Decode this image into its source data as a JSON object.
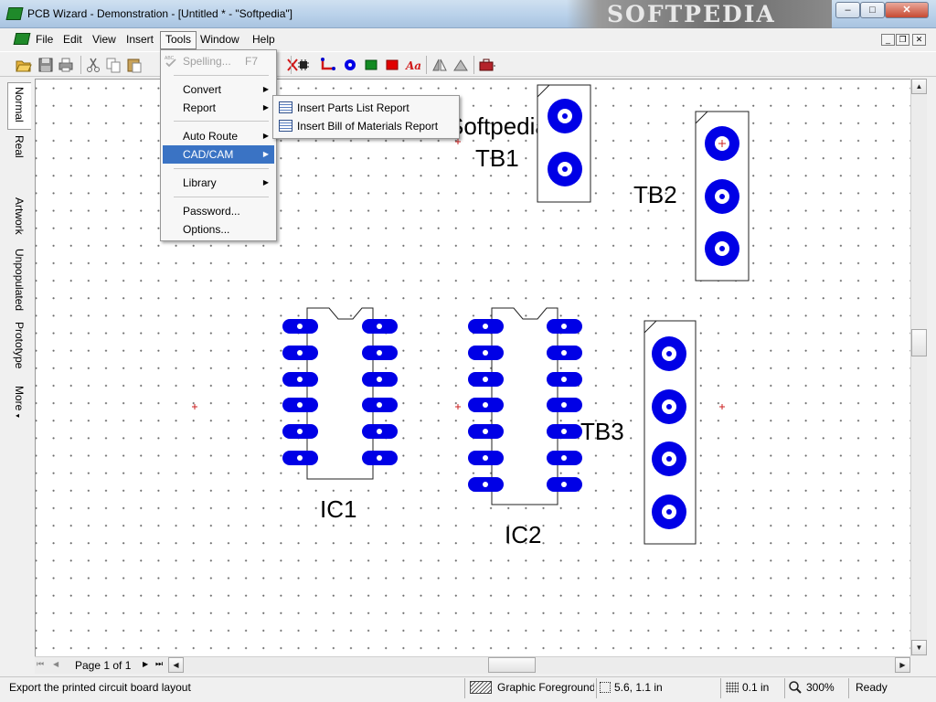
{
  "window": {
    "title": "PCB Wizard - Demonstration - [Untitled * - \"Softpedia\"]",
    "watermark": "SOFTPEDIA",
    "minimize": "–",
    "maximize": "□",
    "close": "✕"
  },
  "menubar": {
    "items": [
      "File",
      "Edit",
      "View",
      "Insert",
      "Tools",
      "Window",
      "Help"
    ],
    "active": "Tools",
    "mdi_minimize": "_",
    "mdi_restore": "❐",
    "mdi_close": "✕"
  },
  "tools_menu": {
    "spelling": {
      "label": "Spelling...",
      "shortcut": "F7",
      "disabled": true
    },
    "items": [
      {
        "label": "Convert",
        "submenu": true
      },
      {
        "label": "Report",
        "submenu": true
      },
      {
        "label": "Auto Route",
        "submenu": true
      },
      {
        "label": "CAD/CAM",
        "submenu": true,
        "highlighted": true
      },
      {
        "label": "Library",
        "submenu": true
      },
      {
        "label": "Password..."
      },
      {
        "label": "Options..."
      }
    ],
    "submenu_arrow": "▶"
  },
  "submenu": {
    "items": [
      "Insert Parts List Report",
      "Insert Bill of Materials Report"
    ]
  },
  "left_tabs": [
    "Normal",
    "Real World",
    "Artwork",
    "Unpopulated",
    "Prototype",
    "More"
  ],
  "left_tabs_more_arrow": "◂",
  "canvas": {
    "labels": {
      "softpedia": "Softpedia",
      "tb1": "TB1",
      "tb2": "TB2",
      "tb3": "TB3",
      "ic1": "IC1",
      "ic2": "IC2"
    },
    "pad_color": "#0000e6",
    "origin_color": "#cc2222"
  },
  "pagination": {
    "label": "Page 1 of 1",
    "first": "⏮",
    "prev": "◀",
    "next": "▶",
    "last": "⏭",
    "scroll_left": "◀",
    "scroll_right": "▶"
  },
  "scrollbar": {
    "up": "▲",
    "down": "▼"
  },
  "status": {
    "message": "Export the printed circuit board layout",
    "layer": "Graphic Foreground",
    "coords": "5.6, 1.1 in",
    "grid": "0.1 in",
    "zoom": "300%",
    "state": "Ready"
  }
}
